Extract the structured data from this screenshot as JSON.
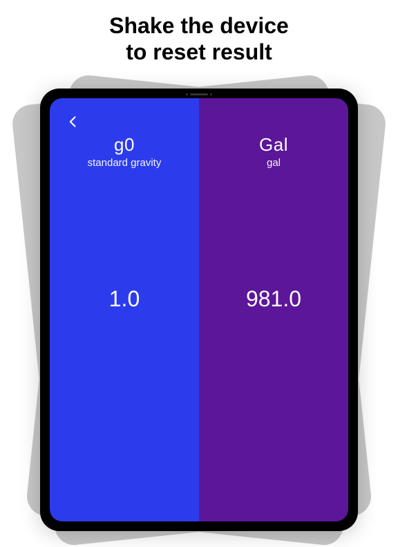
{
  "heading": {
    "line1": "Shake the device",
    "line2": "to reset result"
  },
  "left_pane": {
    "symbol": "g0",
    "name": "standard gravity",
    "value": "1.0",
    "background": "#2c3cec"
  },
  "right_pane": {
    "symbol": "Gal",
    "name": "gal",
    "value": "981.0",
    "background": "#5b169a"
  }
}
